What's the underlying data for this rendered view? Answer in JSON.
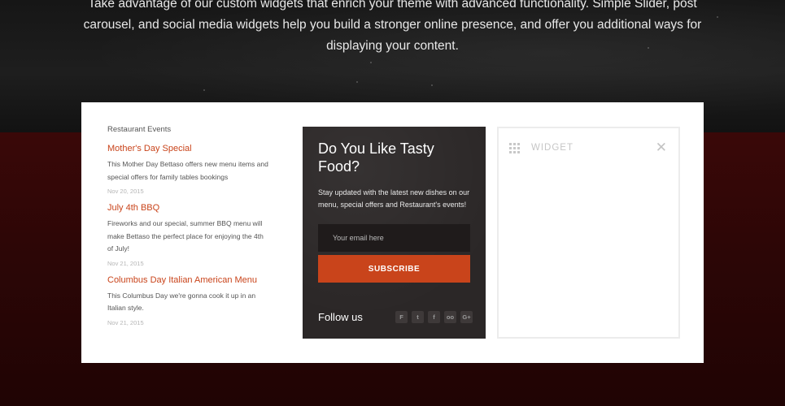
{
  "intro": {
    "text": "Take advantage of our custom widgets that enrich your theme with advanced functionality. Simple Slider, post carousel, and social media widgets help you build a stronger online presence, and offer you additional ways for displaying your content."
  },
  "events": {
    "heading": "Restaurant Events",
    "items": [
      {
        "title": "Mother's Day Special",
        "description": "This Mother Day Bettaso offers new menu items and special offers for family tables bookings",
        "date": "Nov 20, 2015"
      },
      {
        "title": "July 4th BBQ",
        "description": "Fireworks and our special, summer BBQ menu will make Bettaso the perfect place for enjoying the 4th of July!",
        "date": "Nov 21, 2015"
      },
      {
        "title": "Columbus Day Italian American Menu",
        "description": "This Columbus Day we're gonna cook it up in an Italian style.",
        "date": "Nov 21, 2015"
      }
    ]
  },
  "newsletter": {
    "title": "Do You Like Tasty Food?",
    "text": "Stay updated with the latest new dishes on our menu, special offers and Restaurant's events!",
    "email_placeholder": "Your email here",
    "subscribe_label": "SUBSCRIBE",
    "follow_label": "Follow us",
    "social": [
      {
        "name": "foursquare-icon",
        "glyph": "F"
      },
      {
        "name": "twitter-icon",
        "glyph": "t"
      },
      {
        "name": "facebook-icon",
        "glyph": "f"
      },
      {
        "name": "tripadvisor-icon",
        "glyph": "oo"
      },
      {
        "name": "google-plus-icon",
        "glyph": "G+"
      }
    ]
  },
  "widget": {
    "label": "WIDGET"
  },
  "colors": {
    "accent": "#c9441b",
    "newsletter_bg": "#2b2727",
    "background_red": "#2a0606"
  }
}
